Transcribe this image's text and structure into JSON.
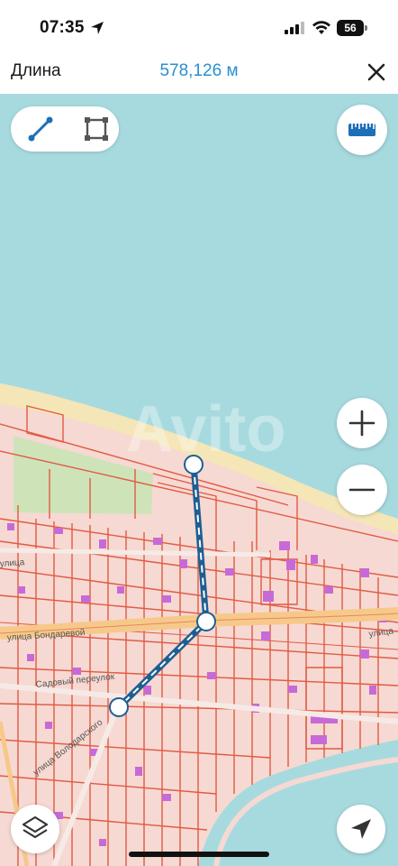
{
  "status_bar": {
    "time": "07:35",
    "battery": "56",
    "icons": [
      "location-arrow-icon",
      "signal-icon",
      "wifi-icon",
      "battery-icon"
    ]
  },
  "header": {
    "title": "Длина",
    "measurement": "578,126 м",
    "close_icon": "close-icon"
  },
  "tools": {
    "line_icon": "line-measure-icon",
    "area_icon": "area-measure-icon",
    "ruler_icon": "ruler-icon"
  },
  "map_controls": {
    "zoom_in": "+",
    "zoom_out": "−",
    "layers_icon": "layers-icon",
    "locate_icon": "locate-arrow-icon"
  },
  "map": {
    "watermark": "Avito",
    "street_labels": [
      "улица Бондаревой",
      "улица",
      "улица Володарского",
      "улица",
      "Садовый переулок"
    ]
  },
  "colors": {
    "water": "#a7dadf",
    "land": "#f6d9d2",
    "parcel_border": "#e05a44",
    "building": "#c76ad8",
    "beach": "#f4e6b6",
    "park": "#cfe3b8",
    "main_road": "#f6c98a",
    "measure_line": "#1d5f93",
    "accent": "#2a8fd0"
  }
}
